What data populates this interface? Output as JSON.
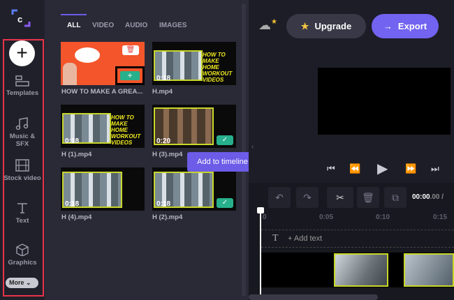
{
  "sidebar": {
    "items": [
      {
        "label": "Templates"
      },
      {
        "label": "Music & SFX"
      },
      {
        "label": "Stock video"
      },
      {
        "label": "Text"
      },
      {
        "label": "Graphics"
      }
    ],
    "more": "More"
  },
  "media": {
    "tabs": [
      "ALL",
      "VIDEO",
      "AUDIO",
      "IMAGES"
    ],
    "items": [
      {
        "name": "HOW TO MAKE A GREA...",
        "duration": ""
      },
      {
        "name": "H.mp4",
        "duration": "0:18"
      },
      {
        "name": "H (1).mp4",
        "duration": "0:18"
      },
      {
        "name": "H (3).mp4",
        "duration": "0:20"
      },
      {
        "name": "H (4).mp4",
        "duration": "0:18"
      },
      {
        "name": "H (2).mp4",
        "duration": "0:18"
      }
    ],
    "thumb_text": "HOW TO MAKE HOME WORKOUT VIDEOS",
    "tooltip": "Add to timeline"
  },
  "header": {
    "upgrade": "Upgrade",
    "export": "Export"
  },
  "timeline": {
    "timecode_current": "00:00",
    "timecode_frac": ".00 / ",
    "ticks": [
      "0",
      "0:05",
      "0:10",
      "0:15"
    ],
    "add_text": "+ Add text"
  },
  "colors": {
    "accent": "#7263f0",
    "red_highlight": "#e8344a",
    "green": "#27b08b"
  }
}
